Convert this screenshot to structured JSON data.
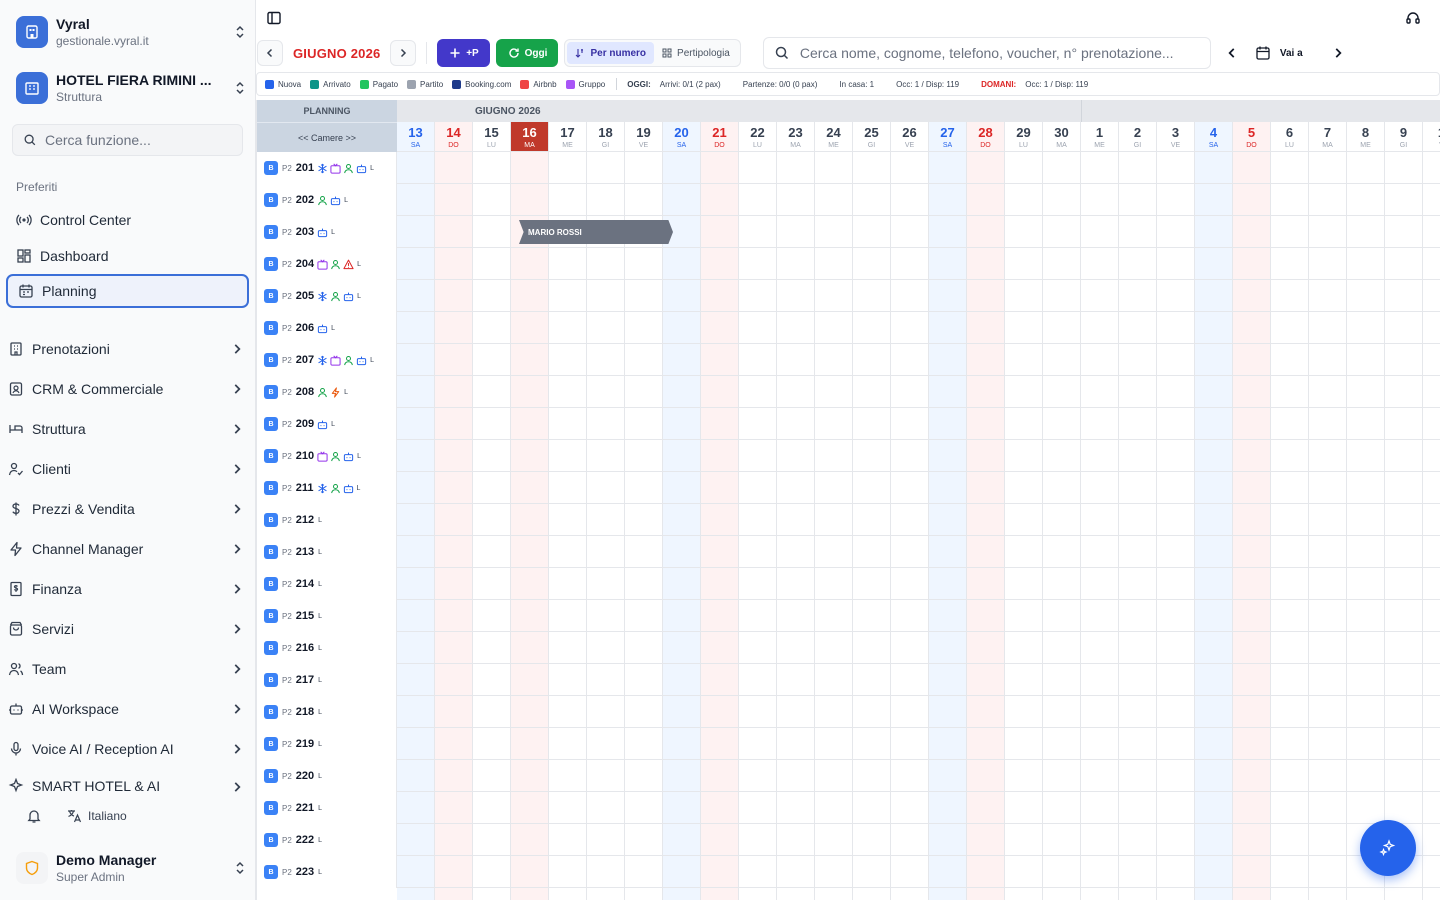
{
  "app": {
    "name": "Vyral",
    "domain": "gestionale.vyral.it"
  },
  "hotel": {
    "name": "HOTEL FIERA RIMINI ...",
    "type": "Struttura"
  },
  "sidebar": {
    "search_placeholder": "Cerca funzione...",
    "favorites_title": "Preferiti",
    "favorites": [
      {
        "label": "Control Center",
        "icon": "broadcast-icon"
      },
      {
        "label": "Dashboard",
        "icon": "dashboard-icon"
      },
      {
        "label": "Planning",
        "icon": "calendar-icon",
        "active": true
      }
    ],
    "items": [
      {
        "label": "Prenotazioni",
        "icon": "building-icon"
      },
      {
        "label": "CRM & Commerciale",
        "icon": "contact-icon"
      },
      {
        "label": "Struttura",
        "icon": "bed-icon"
      },
      {
        "label": "Clienti",
        "icon": "user-check-icon"
      },
      {
        "label": "Prezzi & Vendita",
        "icon": "dollar-icon"
      },
      {
        "label": "Channel Manager",
        "icon": "zap-icon"
      },
      {
        "label": "Finanza",
        "icon": "receipt-icon"
      },
      {
        "label": "Servizi",
        "icon": "bag-icon"
      },
      {
        "label": "Team",
        "icon": "users-icon"
      },
      {
        "label": "AI Workspace",
        "icon": "bot-icon"
      },
      {
        "label": "Voice AI / Reception AI",
        "icon": "mic-icon"
      },
      {
        "label": "SMART HOTEL & AI",
        "icon": "sparkle-icon"
      }
    ],
    "language": "Italiano",
    "user": {
      "name": "Demo Manager",
      "role": "Super Admin"
    }
  },
  "toolbar": {
    "month_label": "GIUGNO 2026",
    "add_label": "+P",
    "today_label": "Oggi",
    "view_by_number": "Per numero",
    "view_by_type": "Pertipologia",
    "search_placeholder": "Cerca nome, cognome, telefono, voucher, n° prenotazione...",
    "goto_label": "Vai a"
  },
  "legend": {
    "items": [
      {
        "label": "Nuova",
        "color": "#2563eb"
      },
      {
        "label": "Arrivato",
        "color": "#0d9488"
      },
      {
        "label": "Pagato",
        "color": "#22c55e"
      },
      {
        "label": "Partito",
        "color": "#9ca3af"
      },
      {
        "label": "Booking.com",
        "color": "#1e3a8a"
      },
      {
        "label": "Airbnb",
        "color": "#ef4444"
      },
      {
        "label": "Gruppo",
        "color": "#a855f7"
      }
    ],
    "today_title": "OGGI:",
    "arrivals": "Arrivi: 0/1 (2 pax)",
    "departures": "Partenze: 0/0 (0 pax)",
    "in_house": "In casa: 1",
    "occ_today": "Occ: 1 / Disp: 119",
    "tomorrow_title": "DOMANI:",
    "occ_tomorrow": "Occ: 1 / Disp: 119"
  },
  "planning": {
    "header_title": "PLANNING",
    "rooms_nav": "<< Camere >>",
    "month_june": "GIUGNO 2026",
    "days": [
      {
        "num": "13",
        "dow": "SA",
        "kind": "sat"
      },
      {
        "num": "14",
        "dow": "DO",
        "kind": "sun"
      },
      {
        "num": "15",
        "dow": "LU",
        "kind": ""
      },
      {
        "num": "16",
        "dow": "MA",
        "kind": "today"
      },
      {
        "num": "17",
        "dow": "ME",
        "kind": ""
      },
      {
        "num": "18",
        "dow": "GI",
        "kind": ""
      },
      {
        "num": "19",
        "dow": "VE",
        "kind": ""
      },
      {
        "num": "20",
        "dow": "SA",
        "kind": "sat"
      },
      {
        "num": "21",
        "dow": "DO",
        "kind": "sun"
      },
      {
        "num": "22",
        "dow": "LU",
        "kind": ""
      },
      {
        "num": "23",
        "dow": "MA",
        "kind": ""
      },
      {
        "num": "24",
        "dow": "ME",
        "kind": ""
      },
      {
        "num": "25",
        "dow": "GI",
        "kind": ""
      },
      {
        "num": "26",
        "dow": "VE",
        "kind": ""
      },
      {
        "num": "27",
        "dow": "SA",
        "kind": "sat"
      },
      {
        "num": "28",
        "dow": "DO",
        "kind": "sun"
      },
      {
        "num": "29",
        "dow": "LU",
        "kind": ""
      },
      {
        "num": "30",
        "dow": "MA",
        "kind": ""
      },
      {
        "num": "1",
        "dow": "ME",
        "kind": ""
      },
      {
        "num": "2",
        "dow": "GI",
        "kind": ""
      },
      {
        "num": "3",
        "dow": "VE",
        "kind": ""
      },
      {
        "num": "4",
        "dow": "SA",
        "kind": "sat"
      },
      {
        "num": "5",
        "dow": "DO",
        "kind": "sun"
      },
      {
        "num": "6",
        "dow": "LU",
        "kind": ""
      },
      {
        "num": "7",
        "dow": "MA",
        "kind": ""
      },
      {
        "num": "8",
        "dow": "ME",
        "kind": ""
      },
      {
        "num": "9",
        "dow": "GI",
        "kind": ""
      },
      {
        "num": "1",
        "dow": "V",
        "kind": ""
      }
    ],
    "rooms": [
      {
        "floor": "P2",
        "number": "201",
        "icons": [
          "snowflake-icon",
          "tv-icon",
          "person-icon",
          "bot-icon"
        ],
        "flag": "L"
      },
      {
        "floor": "P2",
        "number": "202",
        "icons": [
          "person-icon",
          "bot-icon"
        ],
        "flag": "L"
      },
      {
        "floor": "P2",
        "number": "203",
        "icons": [
          "bot-icon"
        ],
        "flag": "L"
      },
      {
        "floor": "P2",
        "number": "204",
        "icons": [
          "tv-icon",
          "person-icon",
          "warning-icon"
        ],
        "flag": "L"
      },
      {
        "floor": "P2",
        "number": "205",
        "icons": [
          "snowflake-icon",
          "person-icon",
          "bot-icon"
        ],
        "flag": "L"
      },
      {
        "floor": "P2",
        "number": "206",
        "icons": [
          "bot-icon"
        ],
        "flag": "L"
      },
      {
        "floor": "P2",
        "number": "207",
        "icons": [
          "snowflake-icon",
          "tv-icon",
          "person-icon",
          "bot-icon"
        ],
        "flag": "L"
      },
      {
        "floor": "P2",
        "number": "208",
        "icons": [
          "person-icon",
          "bolt-icon"
        ],
        "flag": "L"
      },
      {
        "floor": "P2",
        "number": "209",
        "icons": [
          "bot-icon"
        ],
        "flag": "L"
      },
      {
        "floor": "P2",
        "number": "210",
        "icons": [
          "tv-icon",
          "person-icon",
          "bot-icon"
        ],
        "flag": "L"
      },
      {
        "floor": "P2",
        "number": "211",
        "icons": [
          "snowflake-icon",
          "person-icon",
          "bot-icon"
        ],
        "flag": "L"
      },
      {
        "floor": "P2",
        "number": "212",
        "icons": [],
        "flag": "L"
      },
      {
        "floor": "P2",
        "number": "213",
        "icons": [],
        "flag": "L"
      },
      {
        "floor": "P2",
        "number": "214",
        "icons": [],
        "flag": "L"
      },
      {
        "floor": "P2",
        "number": "215",
        "icons": [],
        "flag": "L"
      },
      {
        "floor": "P2",
        "number": "216",
        "icons": [],
        "flag": "L"
      },
      {
        "floor": "P2",
        "number": "217",
        "icons": [],
        "flag": "L"
      },
      {
        "floor": "P2",
        "number": "218",
        "icons": [],
        "flag": "L"
      },
      {
        "floor": "P2",
        "number": "219",
        "icons": [],
        "flag": "L"
      },
      {
        "floor": "P2",
        "number": "220",
        "icons": [],
        "flag": "L"
      },
      {
        "floor": "P2",
        "number": "221",
        "icons": [],
        "flag": "L"
      },
      {
        "floor": "P2",
        "number": "222",
        "icons": [],
        "flag": "L"
      },
      {
        "floor": "P2",
        "number": "223",
        "icons": [],
        "flag": "L"
      }
    ],
    "bookings": [
      {
        "guest": "MARIO ROSSI",
        "room": "203",
        "from": "16",
        "to": "20"
      }
    ]
  }
}
